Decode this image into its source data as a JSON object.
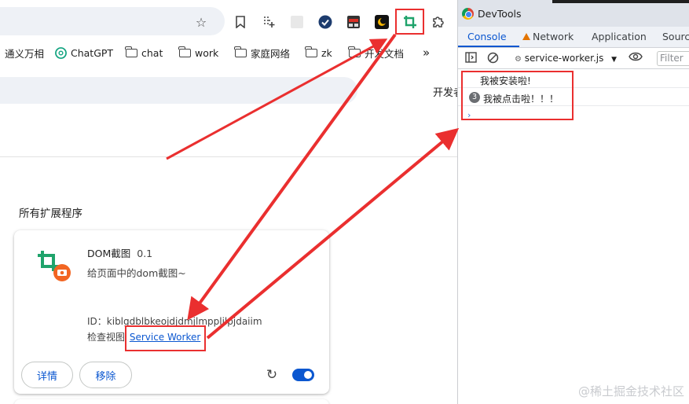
{
  "toolbar": {
    "icons": [
      "star-icon",
      "bookmark-icon",
      "tab-search-icon",
      "blank-extension-icon",
      "blue-check-extension-icon",
      "calendar-extension-icon",
      "moon-extension-icon",
      "crop-extension-icon",
      "puzzle-icon"
    ]
  },
  "bookmarks": {
    "items": [
      "通义万相",
      "ChatGPT",
      "chat",
      "work",
      "家庭网络",
      "zk",
      "开发文档"
    ],
    "more": "»"
  },
  "page": {
    "dev_label": "开发者",
    "section_title": "所有扩展程序"
  },
  "extension": {
    "name": "DOM截图",
    "version": "0.1",
    "description": "给页面中的dom截图~",
    "id_label": "ID：",
    "id_value": "kiblgdblbkeojdjdmjlmpplilpjdaiim",
    "view_label": "检查视图",
    "view_link": "Service Worker",
    "details_button": "详情",
    "remove_button": "移除",
    "enabled": true
  },
  "devtools": {
    "title": "DevTools",
    "tabs": [
      "Console",
      "Network",
      "Application",
      "Sources"
    ],
    "active_tab": "Console",
    "context": "service-worker.js",
    "context_arrow": "▼",
    "filter_placeholder": "Filter",
    "messages": [
      {
        "count": "",
        "text": "我被安装啦!"
      },
      {
        "count": "3",
        "text": "我被点击啦！！！"
      }
    ],
    "prompt": "›"
  },
  "watermark": "@稀土掘金技术社区",
  "colors": {
    "accent": "#0b57d0",
    "annotation_red": "#ea2f2f",
    "extension_green": "#1fa36b",
    "extension_orange": "#f26522"
  }
}
